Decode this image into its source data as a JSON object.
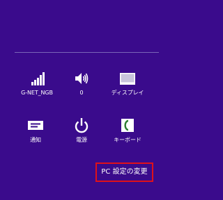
{
  "settings_pane": {
    "tiles": [
      {
        "label": "G-NET_NGB",
        "icon": "wifi-signal-icon"
      },
      {
        "label": "0",
        "icon": "speaker-volume-icon"
      },
      {
        "label": "ディスプレイ",
        "icon": "display-icon"
      },
      {
        "label": "通知",
        "icon": "notification-icon"
      },
      {
        "label": "電源",
        "icon": "power-icon"
      },
      {
        "label": "キーボード",
        "icon": "keyboard-icon"
      }
    ],
    "change_pc_settings_label": "PC 設定の変更"
  },
  "colors": {
    "background": "#3a0b8c",
    "divider": "#7a66b8",
    "highlight_border": "#e0111a",
    "foreground": "#ffffff"
  }
}
